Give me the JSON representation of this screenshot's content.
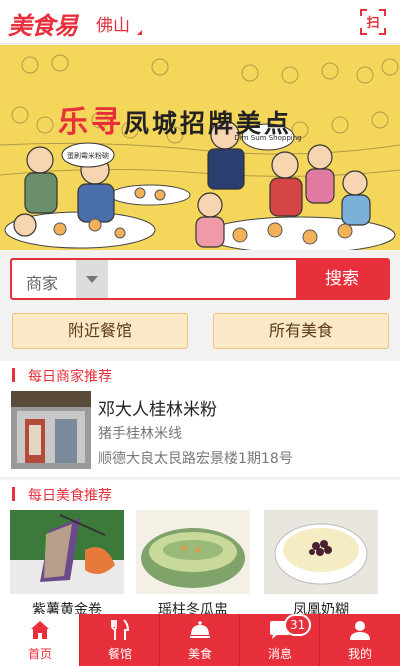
{
  "header": {
    "logo": "美食易",
    "city": "佛山",
    "scan_glyph": "扫"
  },
  "banner": {
    "title_accent": "乐寻",
    "title_rest": "凤城招牌美点",
    "bubble_left": "蛋刷霉米粉碗",
    "bubble_right": "Dim Sum Shopping"
  },
  "search": {
    "type_label": "商家",
    "placeholder": "",
    "button_label": "搜索"
  },
  "quick": {
    "nearby_label": "附近餐馆",
    "all_food_label": "所有美食"
  },
  "merchant_section": {
    "title": "每日商家推荐",
    "merchant": {
      "name": "邓大人桂林米粉",
      "type": "猪手桂林米线",
      "address": "顺德大良太艮路宏景楼1期18号"
    }
  },
  "food_section": {
    "title": "每日美食推荐",
    "items": [
      {
        "name": "紫薯黄金卷"
      },
      {
        "name": "瑶柱冬瓜盅"
      },
      {
        "name": "凤凰奶糊"
      }
    ]
  },
  "tabbar": {
    "tabs": [
      {
        "label": "首页",
        "icon": "home-icon"
      },
      {
        "label": "餐馆",
        "icon": "fork-knife-icon"
      },
      {
        "label": "美食",
        "icon": "cloche-icon"
      },
      {
        "label": "消息",
        "icon": "chat-icon"
      },
      {
        "label": "我的",
        "icon": "person-icon"
      }
    ],
    "message_badge": "31"
  },
  "colors": {
    "brand_red": "#e8303c",
    "banner_yellow": "#f4d75a",
    "quick_bg": "#fbe8c7"
  }
}
